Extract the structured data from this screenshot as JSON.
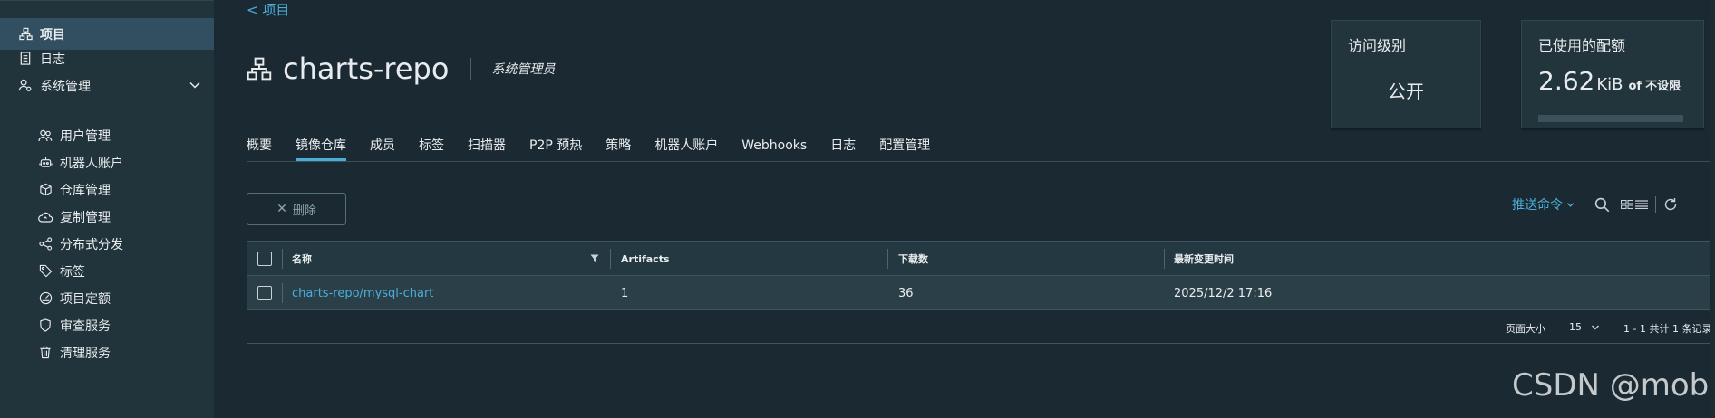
{
  "sidebar": {
    "items": [
      {
        "label": "项目",
        "icon": "project-icon",
        "active": true
      },
      {
        "label": "日志",
        "icon": "log-icon"
      },
      {
        "label": "系统管理",
        "icon": "admin-icon"
      },
      {
        "label": "用户管理",
        "icon": "users-icon"
      },
      {
        "label": "机器人账户",
        "icon": "robot-icon"
      },
      {
        "label": "仓库管理",
        "icon": "cube-icon"
      },
      {
        "label": "复制管理",
        "icon": "cloud-icon"
      },
      {
        "label": "分布式分发",
        "icon": "share-icon"
      },
      {
        "label": "标签",
        "icon": "tag-icon"
      },
      {
        "label": "项目定额",
        "icon": "gauge-icon"
      },
      {
        "label": "审查服务",
        "icon": "shield-icon"
      },
      {
        "label": "清理服务",
        "icon": "trash-icon"
      }
    ]
  },
  "header": {
    "back_label": "< 项目",
    "title": "charts-repo",
    "role": "系统管理员"
  },
  "cards": {
    "access": {
      "label": "访问级别",
      "value": "公开"
    },
    "quota": {
      "label": "已使用的配额",
      "value": "2.62",
      "unit": "KiB",
      "of": "of",
      "limit": "不设限",
      "used_fraction": 0
    }
  },
  "tabs": [
    "概要",
    "镜像仓库",
    "成员",
    "标签",
    "扫描器",
    "P2P 预热",
    "策略",
    "机器人账户",
    "Webhooks",
    "日志",
    "配置管理"
  ],
  "active_tab": 1,
  "toolbar": {
    "delete_label": "删除",
    "push_command_label": "推送命令"
  },
  "table": {
    "columns": [
      "名称",
      "Artifacts",
      "下载数",
      "最新变更时间"
    ],
    "rows": [
      {
        "name": "charts-repo/mysql-chart",
        "artifacts": "1",
        "downloads": "36",
        "updated": "2025/12/2 17:16"
      }
    ],
    "page_size_label": "页面大小",
    "page_size": "15",
    "total_label": "1 - 1 共计 1 条记录"
  },
  "watermark": "CSDN @mob",
  "colors": {
    "accent": "#4aaed9",
    "background": "#1b2a32",
    "sidebar": "#21333b",
    "active_item": "#324f61"
  }
}
